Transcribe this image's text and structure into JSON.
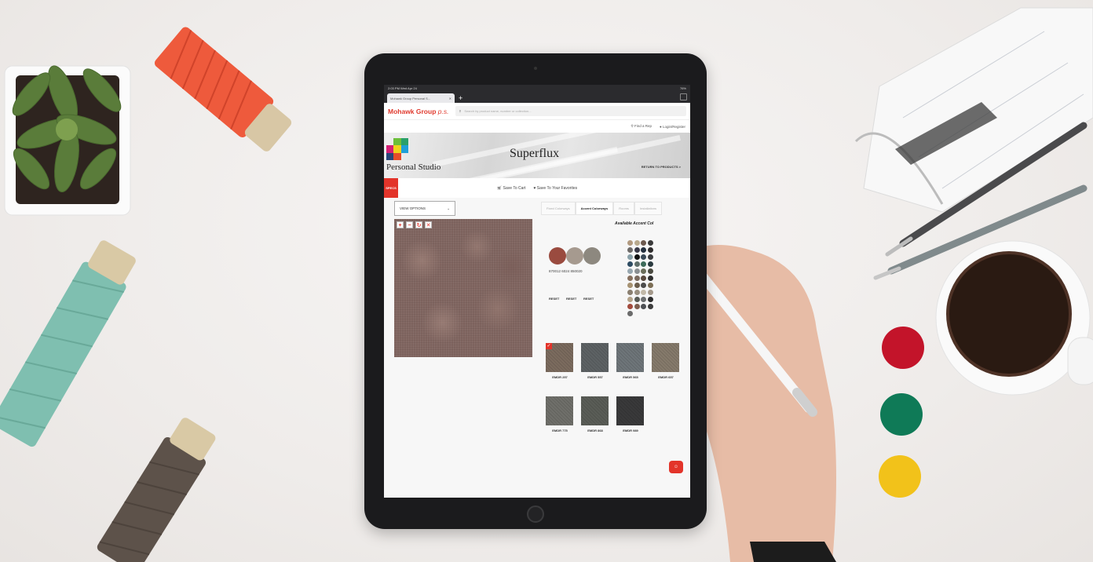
{
  "browser": {
    "status_time": "2:03 PM  Wed Apr 24",
    "status_battery": "76%",
    "tab_title": "Mohawk Group Personal S..."
  },
  "header": {
    "logo": "Mohawk Group",
    "logo_suffix": "p.s.",
    "search_placeholder": "Search by product name, number or collection...",
    "find_rep": "Find a Rep",
    "login": "Login/Register"
  },
  "hero": {
    "studio": "Personal Studio",
    "product": "Superflux",
    "return_link": "RETURN TO PRODUCTS >"
  },
  "actions": {
    "specs": "SPECS",
    "save_cart": "Save To Cart",
    "save_fav": "Save To Your Favorites"
  },
  "controls": {
    "view_options": "VIEW OPTIONS",
    "tabs": [
      "Fixed Colorways",
      "Accent Colorways",
      "Rooms",
      "Installations"
    ],
    "available_label": "Available Accent Col"
  },
  "accents": [
    {
      "code": "870012",
      "color": "#9a4b3f"
    },
    {
      "code": "6024",
      "color": "#a69a8f"
    },
    {
      "code": "850020",
      "color": "#8d887f"
    }
  ],
  "reset_label": "RESET",
  "palette": [
    "#b29a80",
    "#b9aa8e",
    "#6d5a4f",
    "#3a3a3a",
    "#6d6a68",
    "#3a3a48",
    "#24303f",
    "#2d2b2c",
    "#8aa0a8",
    "#111111",
    "#3a4a58",
    "#3b3d40",
    "#2e4c63",
    "#5e6e6a",
    "#3d6b5a",
    "#2a3a3f",
    "#97a7b0",
    "#8a8f92",
    "#6b6e5a",
    "#4a4a40",
    "#87705e",
    "#7a6a5f",
    "#5a4a3f",
    "#2f2f2f",
    "#a69272",
    "#6b5e4d",
    "#4d4d4d",
    "#7c6e55",
    "#8a7f70",
    "#9a9080",
    "#c2b9a8",
    "#a4998b",
    "#b4a48b",
    "#585b55",
    "#6c6f70",
    "#2c2c2c",
    "#a24a3c",
    "#7e5e4f",
    "#4d5054",
    "#3c3c3c",
    "#6b6b6b"
  ],
  "colorways": [
    {
      "label": "EMDR 257",
      "color": "#7b6b5e",
      "checked": true
    },
    {
      "label": "EMDR 557",
      "color": "#5d6264",
      "checked": false
    },
    {
      "label": "EMDR 565",
      "color": "#6e7579",
      "checked": false
    },
    {
      "label": "EMDR 657",
      "color": "#857a6b",
      "checked": false
    },
    {
      "label": "EMDR 775",
      "color": "#6f6f6a",
      "checked": false
    },
    {
      "label": "EMDR 868",
      "color": "#5a5d57",
      "checked": false
    },
    {
      "label": "EMDR 989",
      "color": "#39393a",
      "checked": false
    }
  ]
}
